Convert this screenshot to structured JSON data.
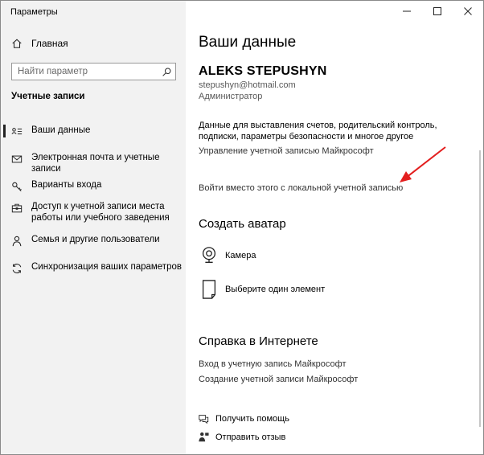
{
  "window": {
    "title": "Параметры",
    "controls": [
      "minimize-icon",
      "maximize-icon",
      "close-icon"
    ]
  },
  "sidebar": {
    "home_label": "Главная",
    "search": {
      "placeholder": "Найти параметр",
      "value": ""
    },
    "section_heading": "Учетные записи",
    "items": [
      {
        "label": "Ваши данные",
        "icon": "your-info-icon",
        "selected": true
      },
      {
        "label": "Электронная почта и учетные записи",
        "icon": "email-icon",
        "selected": false
      },
      {
        "label": "Варианты входа",
        "icon": "key-icon",
        "selected": false
      },
      {
        "label": "Доступ к учетной записи места работы или учебного заведения",
        "icon": "briefcase-icon",
        "selected": false
      },
      {
        "label": "Семья и другие пользователи",
        "icon": "person-icon",
        "selected": false
      },
      {
        "label": "Синхронизация ваших параметров",
        "icon": "sync-icon",
        "selected": false
      }
    ]
  },
  "main": {
    "title": "Ваши данные",
    "user": {
      "name": "ALEKS STEPUSHYN",
      "email": "stepushyn@hotmail.com",
      "role": "Администратор"
    },
    "billing_text": "Данные для выставления счетов, родительский контроль, подписки, параметры безопасности и многое другое",
    "manage_link": "Управление учетной записью Майкрософт",
    "local_account_link": "Войти вместо этого с локальной учетной записью",
    "avatar": {
      "title": "Создать аватар",
      "camera_label": "Камера",
      "browse_label": "Выберите один элемент"
    },
    "help": {
      "title": "Справка в Интернете",
      "links": [
        "Вход в учетную запись Майкрософт",
        "Создание учетной записи Майкрософт"
      ]
    },
    "footer": {
      "get_help": "Получить помощь",
      "feedback": "Отправить отзыв"
    }
  },
  "colors": {
    "sidebar_bg": "#f2f2f2",
    "annotation_arrow": "#e31e1e"
  }
}
